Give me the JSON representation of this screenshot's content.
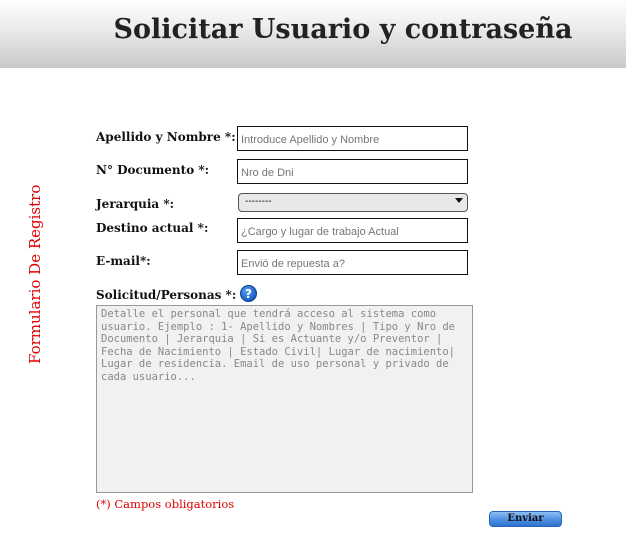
{
  "header": {
    "title": "Solicitar Usuario y contraseña"
  },
  "sidebar": {
    "label": "Formulario De Registro"
  },
  "form": {
    "apellido": {
      "label": "Apellido y Nombre *:",
      "placeholder": "Introduce Apellido y Nombre"
    },
    "documento": {
      "label": "N° Documento *:",
      "placeholder": "Nro de Dni"
    },
    "jerarquia": {
      "label": "Jerarquia *:",
      "selected": "--------"
    },
    "destino": {
      "label": "Destino actual *:",
      "placeholder": "¿Cargo y lugar de trabajo Actual"
    },
    "email": {
      "label": "E-mail*:",
      "placeholder": "Envió de repuesta a?"
    },
    "solicitud": {
      "label": "Solicitud/Personas *:",
      "help_icon": "question-circle-icon",
      "help_glyph": "?",
      "placeholder": "Detalle el personal que tendrá acceso al sistema como\nusuario. Ejemplo : 1- Apellido y Nombres | Tipo y Nro de\nDocumento | Jerarquia | Si es Actuante y/o Preventor |\nFecha de Nacimiento | Estado Civil| Lugar de nacimiento|\nLugar de residencia. Email de uso personal y privado de\ncada usuario..."
    },
    "required_note": "(*) Campos obligatorios",
    "submit_label": "Enviar"
  },
  "colors": {
    "accent_red": "#e00000",
    "button_blue": "#4d8fe0",
    "help_blue": "#1a5fc6"
  }
}
